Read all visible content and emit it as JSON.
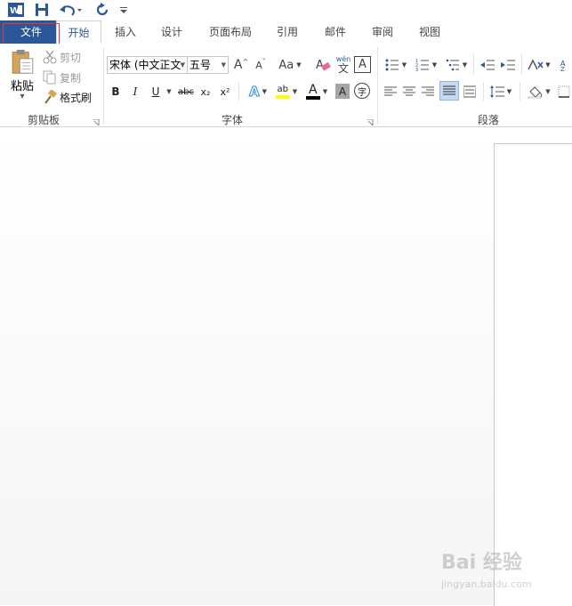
{
  "quick_access": {
    "app_icon": "word-icon",
    "save_icon": "save-icon",
    "undo_icon": "undo-icon",
    "redo_icon": "redo-icon",
    "customize_icon": "customize-qat-icon"
  },
  "tabs": [
    {
      "label": "文件"
    },
    {
      "label": "开始"
    },
    {
      "label": "插入"
    },
    {
      "label": "设计"
    },
    {
      "label": "页面布局"
    },
    {
      "label": "引用"
    },
    {
      "label": "邮件"
    },
    {
      "label": "审阅"
    },
    {
      "label": "视图"
    }
  ],
  "clipboard": {
    "group_label": "剪贴板",
    "paste_label": "粘贴",
    "cut_label": "剪切",
    "copy_label": "复制",
    "format_painter_label": "格式刷"
  },
  "font": {
    "group_label": "字体",
    "font_name": "宋体 (中文正文",
    "font_size": "五号",
    "change_case_label": "Aa",
    "bold_label": "B",
    "italic_label": "I",
    "underline_label": "U",
    "strikethrough_label": "abc",
    "subscript_label": "x₂",
    "superscript_label": "x²",
    "text_effects_label": "A",
    "highlight_label": "ab",
    "font_color_label": "A",
    "char_shading_label": "A",
    "enclose_label": "字",
    "char_border_label": "A",
    "phonetic_top": "wén",
    "phonetic_bottom": "文",
    "grow_label": "A",
    "shrink_label": "A"
  },
  "paragraph": {
    "group_label": "段落"
  },
  "colors": {
    "file_tab": "#2b579a",
    "accent": "#2b579a",
    "highlight": "#ffff00",
    "font_color": "#000000",
    "outline": "#e53935"
  },
  "watermark": {
    "brand": "Bai 经验",
    "url": "jingyan.baidu.com"
  }
}
